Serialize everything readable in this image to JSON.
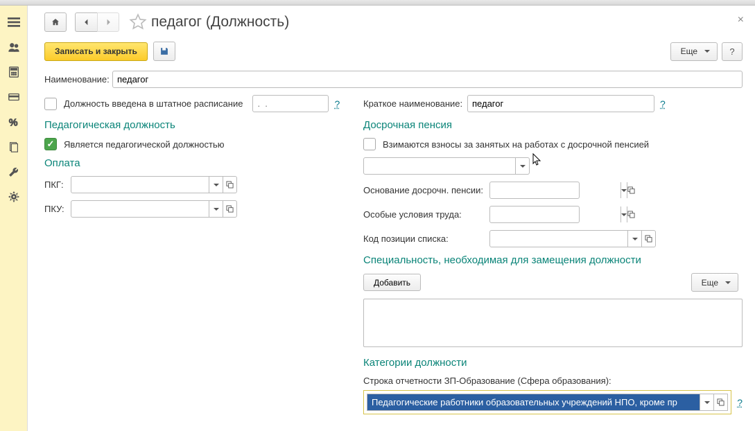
{
  "page_title": "педагог (Должность)",
  "toolbar": {
    "save_close": "Записать и закрыть",
    "more": "Еще",
    "help": "?"
  },
  "name_row": {
    "label": "Наименование:",
    "value": "педагог"
  },
  "staffing": {
    "checkbox_label": "Должность введена в штатное расписание",
    "date_placeholder": ".  .",
    "help": "?"
  },
  "short_name": {
    "label": "Краткое наименование:",
    "value": "педагог",
    "help": "?"
  },
  "ped_section": {
    "title": "Педагогическая должность",
    "is_ped": "Является педагогической должностью"
  },
  "pension_section": {
    "title": "Досрочная пенсия",
    "checkbox_label": "Взимаются взносы за занятых на работах с досрочной пенсией",
    "basis_label": "Основание досрочн. пенсии:",
    "conditions_label": "Особые условия труда:",
    "code_label": "Код позиции списка:"
  },
  "pay_section": {
    "title": "Оплата",
    "pkg_label": "ПКГ:",
    "pku_label": "ПКУ:"
  },
  "spec_section": {
    "title": "Специальность, необходимая для замещения должности",
    "add_btn": "Добавить",
    "more": "Еще"
  },
  "cat_section": {
    "title": "Категории должности",
    "zp_label": "Строка отчетности ЗП-Образование (Сфера образования):",
    "zp_value": "Педагогические работники образовательных учреждений НПО, кроме пр",
    "help": "?"
  }
}
